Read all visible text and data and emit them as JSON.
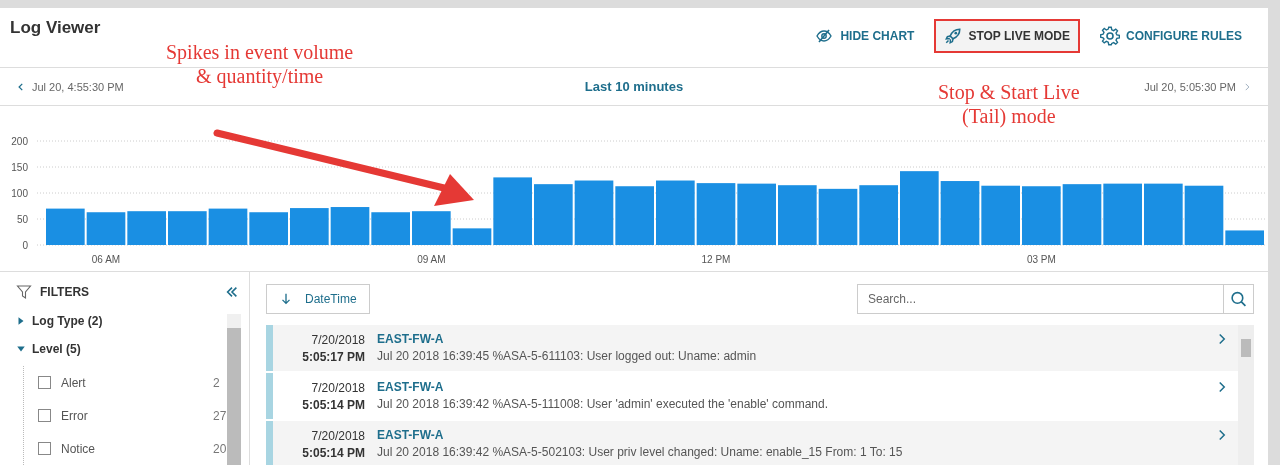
{
  "window": {
    "title": "Log Viewer"
  },
  "toolbar": {
    "buttons": [
      {
        "label": "HIDE CHART",
        "kind": "hide",
        "highlighted": false
      },
      {
        "label": "STOP LIVE MODE",
        "kind": "live",
        "highlighted": true
      },
      {
        "label": "CONFIGURE RULES",
        "kind": "rules",
        "highlighted": false
      }
    ]
  },
  "time_nav": {
    "start": "Jul 20, 4:55:30 PM",
    "range": "Last 10 minutes",
    "end": "Jul 20, 5:05:30 PM"
  },
  "chart": {
    "chart_data": {
      "type": "bar",
      "categories": [
        null,
        "06 AM",
        null,
        null,
        null,
        null,
        null,
        null,
        null,
        "09 AM",
        null,
        null,
        null,
        null,
        null,
        null,
        "12 PM",
        null,
        null,
        null,
        null,
        null,
        null,
        null,
        "03 PM",
        null,
        null,
        null,
        null,
        null
      ],
      "values": [
        70,
        63,
        65,
        65,
        70,
        63,
        71,
        73,
        63,
        65,
        32,
        130,
        117,
        124,
        113,
        124,
        119,
        118,
        115,
        108,
        115,
        142,
        123,
        114,
        113,
        117,
        118,
        118,
        114,
        28
      ],
      "grid": true,
      "ylim": [
        0,
        200
      ],
      "yticks": [
        0,
        50,
        100,
        150,
        200
      ]
    }
  },
  "annotations": [
    {
      "text": "Spikes in event volume\n& quantity/time",
      "kind": "arrow"
    },
    {
      "text": "Stop & Start Live\n(Tail) mode",
      "kind": "note"
    }
  ],
  "filters": {
    "title": "FILTERS",
    "groups": [
      {
        "label": "Log Type (2)",
        "expanded": false
      },
      {
        "label": "Level (5)",
        "expanded": true,
        "children": [
          {
            "label": "Alert",
            "count": "2",
            "checked": false
          },
          {
            "label": "Error",
            "count": "27",
            "checked": false
          },
          {
            "label": "Notice",
            "count": "20",
            "checked": false
          }
        ]
      }
    ]
  },
  "sort": {
    "label": "DateTime"
  },
  "search": {
    "placeholder": "Search..."
  },
  "logs": [
    {
      "date": "7/20/2018",
      "time": "5:05:17 PM",
      "source": "EAST-FW-A",
      "message": "Jul 20 2018 16:39:45 %ASA-5-611103: User logged out: Uname: admin"
    },
    {
      "date": "7/20/2018",
      "time": "5:05:14 PM",
      "source": "EAST-FW-A",
      "message": "Jul 20 2018 16:39:42 %ASA-5-111008: User 'admin' executed the 'enable' command."
    },
    {
      "date": "7/20/2018",
      "time": "5:05:14 PM",
      "source": "EAST-FW-A",
      "message": "Jul 20 2018 16:39:42 %ASA-5-502103: User priv level changed: Uname: enable_15 From: 1 To: 15"
    }
  ]
}
